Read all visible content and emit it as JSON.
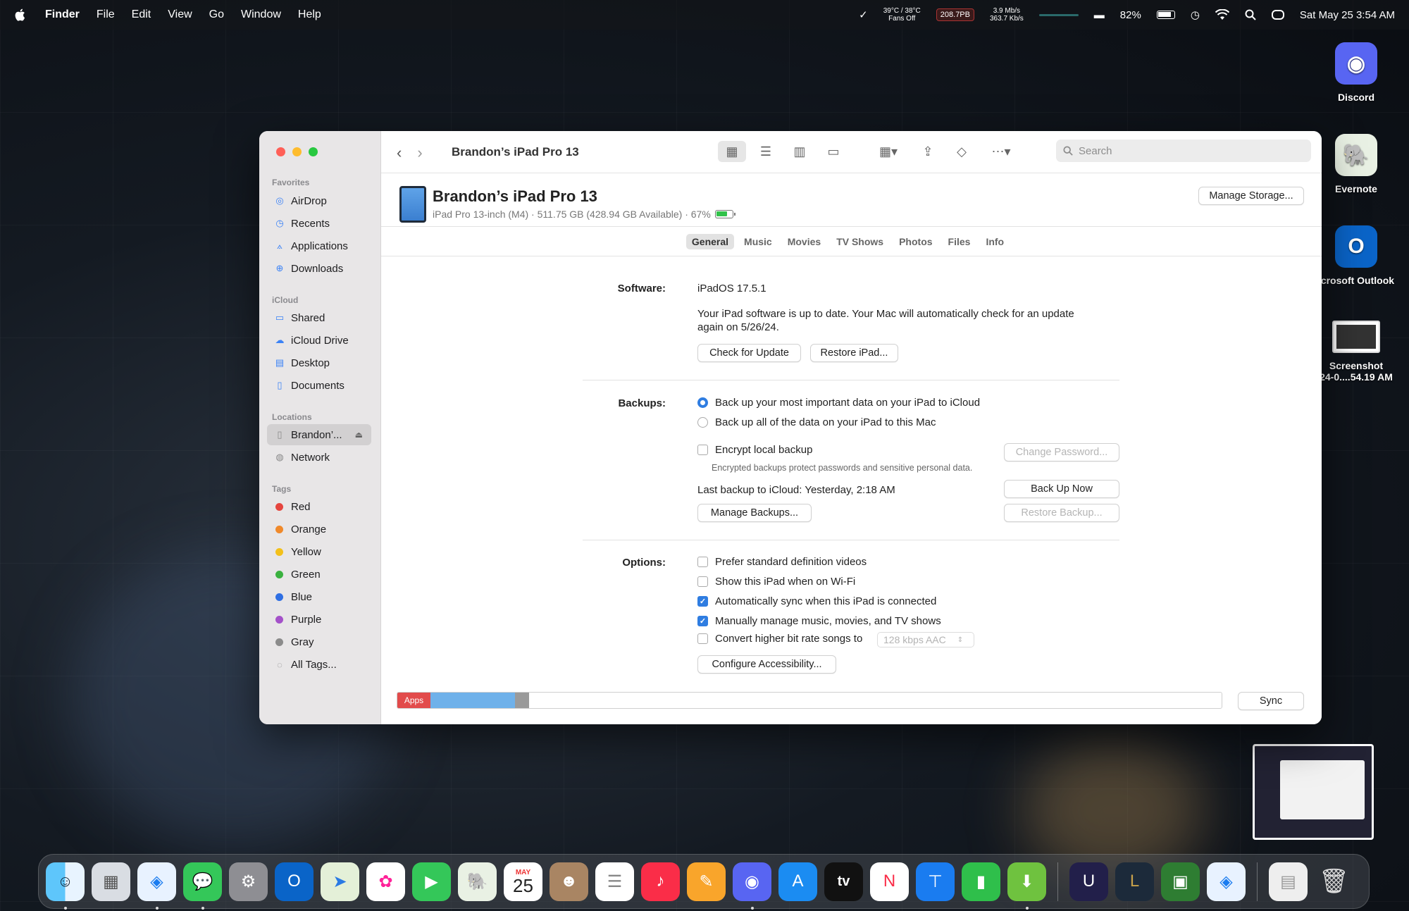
{
  "menubar": {
    "app": "Finder",
    "items": [
      "File",
      "Edit",
      "View",
      "Go",
      "Window",
      "Help"
    ],
    "temps": "39°C / 38°C",
    "fans": "Fans Off",
    "disk": "208.7PB",
    "net_up": "3.9 Mb/s",
    "net_down": "363.7 Kb/s",
    "battery": "82%",
    "clock": "Sat May 25  3:54 AM"
  },
  "window": {
    "title": "Brandon’s iPad Pro 13",
    "search_placeholder": "Search"
  },
  "sidebar": {
    "favorites_label": "Favorites",
    "favorites": [
      "AirDrop",
      "Recents",
      "Applications",
      "Downloads"
    ],
    "icloud_label": "iCloud",
    "icloud": [
      "Shared",
      "iCloud Drive",
      "Desktop",
      "Documents"
    ],
    "locations_label": "Locations",
    "locations": [
      "Brandon’...",
      "Network"
    ],
    "tags_label": "Tags",
    "tags": [
      {
        "name": "Red",
        "color": "#e5453e"
      },
      {
        "name": "Orange",
        "color": "#f0892a"
      },
      {
        "name": "Yellow",
        "color": "#f3c01a"
      },
      {
        "name": "Green",
        "color": "#3ab13f"
      },
      {
        "name": "Blue",
        "color": "#2f6fe3"
      },
      {
        "name": "Purple",
        "color": "#a451c9"
      },
      {
        "name": "Gray",
        "color": "#8b8b8b"
      }
    ],
    "all_tags": "All Tags..."
  },
  "device": {
    "name": "Brandon’s iPad Pro 13",
    "subtitle": "iPad Pro 13-inch (M4) · 511.75 GB (428.94 GB Available) · 67%",
    "manage_storage": "Manage Storage..."
  },
  "tabs": [
    "General",
    "Music",
    "Movies",
    "TV Shows",
    "Photos",
    "Files",
    "Info"
  ],
  "software": {
    "label": "Software:",
    "version": "iPadOS 17.5.1",
    "message_line1": "Your iPad software is up to date. Your Mac will automatically check for an update",
    "message_line2": "again on 5/26/24.",
    "check_update": "Check for Update",
    "restore": "Restore iPad..."
  },
  "backups": {
    "label": "Backups:",
    "opt_icloud": "Back up your most important data on your iPad to iCloud",
    "opt_mac": "Back up all of the data on your iPad to this Mac",
    "encrypt": "Encrypt local backup",
    "encrypt_note": "Encrypted backups protect passwords and sensitive personal data.",
    "change_password": "Change Password...",
    "last_backup": "Last backup to iCloud: Yesterday, 2:18 AM",
    "back_up_now": "Back Up Now",
    "manage_backups": "Manage Backups...",
    "restore_backup": "Restore Backup..."
  },
  "options": {
    "label": "Options:",
    "items": [
      {
        "text": "Prefer standard definition videos",
        "checked": false
      },
      {
        "text": "Show this iPad when on Wi-Fi",
        "checked": false
      },
      {
        "text": "Automatically sync when this iPad is connected",
        "checked": true
      },
      {
        "text": "Manually manage music, movies, and TV shows",
        "checked": true
      }
    ],
    "convert": "Convert higher bit rate songs to",
    "convert_value": "128 kbps AAC",
    "configure": "Configure Accessibility..."
  },
  "storage": {
    "apps_label": "Apps",
    "sync": "Sync"
  },
  "desktop": {
    "icons": [
      "Discord",
      "Evernote",
      "icrosoft Outlook",
      "Screenshot",
      "24-0....54.19 AM"
    ]
  },
  "dock": {
    "calendar_month": "MAY",
    "calendar_day": "25",
    "tv_label": "tv"
  }
}
